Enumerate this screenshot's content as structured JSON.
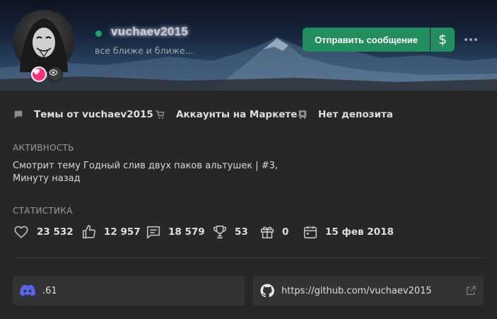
{
  "profile": {
    "username": "vuchaev2015",
    "status_text": "все ближе и ближе...",
    "online": true,
    "colors": {
      "online": "#1fa463",
      "accent_green": "#228e5d",
      "heart_badge": "#ff2f7a"
    }
  },
  "actions": {
    "send_message": "Отправить сообщение",
    "money_icon": "dollar-icon",
    "more_icon": "more-icon"
  },
  "links": [
    {
      "icon": "message-icon",
      "label": "Темы от vuchaev2015"
    },
    {
      "icon": "cart-icon",
      "label": "Аккаунты на Маркете"
    },
    {
      "icon": "deposit-icon",
      "label": "Нет депозита"
    }
  ],
  "activity": {
    "title": "АКТИВНОСТЬ",
    "text": "Смотрит тему Годный слив двух паков альтушек | #3, Минуту назад"
  },
  "stats": {
    "title": "СТАТИСТИКА",
    "items": [
      {
        "icon": "heart-icon",
        "value": "23 532"
      },
      {
        "icon": "thumbs-up-icon",
        "value": "12 957"
      },
      {
        "icon": "comment-icon",
        "value": "18 579"
      },
      {
        "icon": "trophy-icon",
        "value": "53"
      },
      {
        "icon": "gift-icon",
        "value": "0"
      },
      {
        "icon": "calendar-icon",
        "value": "15 фев 2018"
      }
    ]
  },
  "contacts": {
    "discord": ".61",
    "github": "https://github.com/vuchaev2015"
  }
}
